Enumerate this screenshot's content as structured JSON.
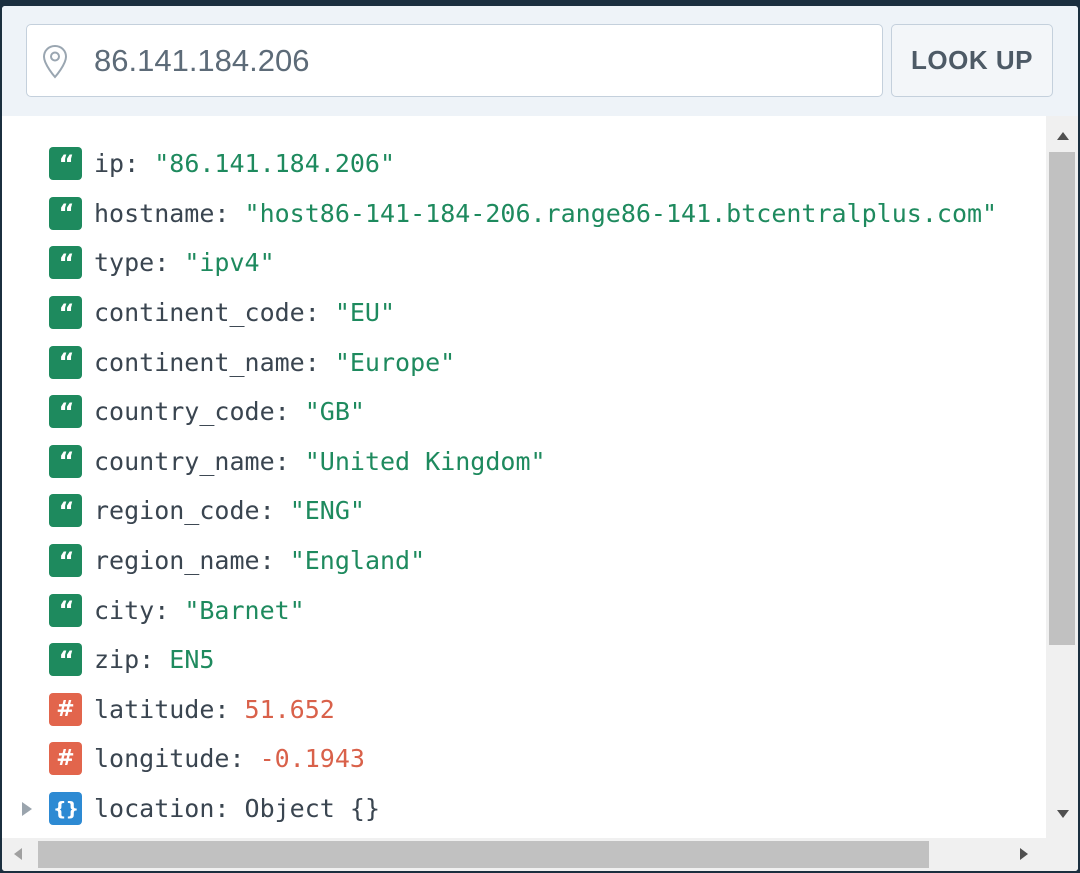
{
  "search": {
    "value": "86.141.184.206",
    "button_label": "LOOK UP",
    "icon": "map-pin-icon"
  },
  "fields": [
    {
      "key": "ip",
      "value": "\"86.141.184.206\"",
      "type": "string"
    },
    {
      "key": "hostname",
      "value": "\"host86-141-184-206.range86-141.btcentralplus.com\"",
      "type": "string"
    },
    {
      "key": "type",
      "value": "\"ipv4\"",
      "type": "string"
    },
    {
      "key": "continent_code",
      "value": "\"EU\"",
      "type": "string"
    },
    {
      "key": "continent_name",
      "value": "\"Europe\"",
      "type": "string"
    },
    {
      "key": "country_code",
      "value": "\"GB\"",
      "type": "string"
    },
    {
      "key": "country_name",
      "value": "\"United Kingdom\"",
      "type": "string"
    },
    {
      "key": "region_code",
      "value": "\"ENG\"",
      "type": "string"
    },
    {
      "key": "region_name",
      "value": "\"England\"",
      "type": "string"
    },
    {
      "key": "city",
      "value": "\"Barnet\"",
      "type": "string"
    },
    {
      "key": "zip",
      "value": "EN5",
      "type": "string"
    },
    {
      "key": "latitude",
      "value": "51.652",
      "type": "number"
    },
    {
      "key": "longitude",
      "value": "-0.1943",
      "type": "number"
    },
    {
      "key": "location",
      "value": "Object {}",
      "type": "object",
      "expandable": true
    }
  ],
  "badges": {
    "string": "“",
    "number": "#",
    "object": "{}"
  },
  "colors": {
    "string_badge": "#1e8a5e",
    "number_badge": "#e2654c",
    "object_badge": "#2d8ad3",
    "string_value": "#1e8a5e",
    "number_value": "#d9614a"
  }
}
